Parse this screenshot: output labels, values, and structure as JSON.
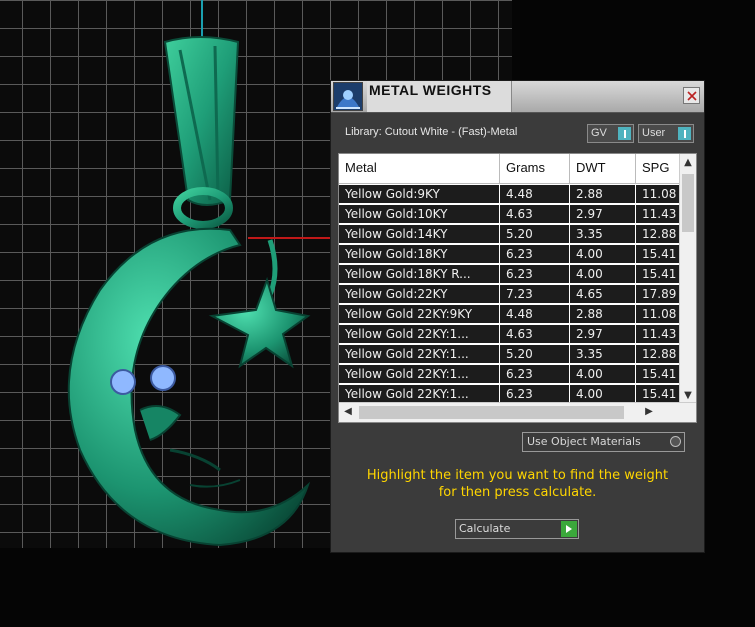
{
  "window": {
    "title": "METAL WEIGHTS",
    "library_label": "Library: Cutout White - (Fast)-Metal",
    "toggle_gv": "GV",
    "toggle_user": "User",
    "close_icon": "close-icon",
    "app_icon": "jeweller-app-icon"
  },
  "table": {
    "columns": [
      "Metal",
      "Grams",
      "DWT",
      "SPG"
    ],
    "rows": [
      {
        "metal": "Yellow Gold:9KY",
        "grams": "4.48",
        "dwt": "2.88",
        "spg": "11.08"
      },
      {
        "metal": "Yellow Gold:10KY",
        "grams": "4.63",
        "dwt": "2.97",
        "spg": "11.43"
      },
      {
        "metal": "Yellow Gold:14KY",
        "grams": "5.20",
        "dwt": "3.35",
        "spg": "12.88"
      },
      {
        "metal": "Yellow Gold:18KY",
        "grams": "6.23",
        "dwt": "4.00",
        "spg": "15.41"
      },
      {
        "metal": "Yellow Gold:18KY R...",
        "grams": "6.23",
        "dwt": "4.00",
        "spg": "15.41"
      },
      {
        "metal": "Yellow Gold:22KY",
        "grams": "7.23",
        "dwt": "4.65",
        "spg": "17.89"
      },
      {
        "metal": "Yellow Gold 22KY:9KY",
        "grams": "4.48",
        "dwt": "2.88",
        "spg": "11.08"
      },
      {
        "metal": "Yellow Gold 22KY:1...",
        "grams": "4.63",
        "dwt": "2.97",
        "spg": "11.43"
      },
      {
        "metal": "Yellow Gold 22KY:1...",
        "grams": "5.20",
        "dwt": "3.35",
        "spg": "12.88"
      },
      {
        "metal": "Yellow Gold 22KY:1...",
        "grams": "6.23",
        "dwt": "4.00",
        "spg": "15.41"
      },
      {
        "metal": "Yellow Gold 22KY:1...",
        "grams": "6.23",
        "dwt": "4.00",
        "spg": "15.41"
      }
    ]
  },
  "controls": {
    "use_object_materials": "Use Object Materials",
    "instruction_line1": "Highlight the item you want to find the weight",
    "instruction_line2": "for then press calculate.",
    "calculate_label": "Calculate"
  },
  "colors": {
    "accent_yellow": "#ffd600",
    "model_green": "#1f9e78",
    "toggle_teal": "#4fb3bf",
    "calc_green": "#3ba83b"
  }
}
